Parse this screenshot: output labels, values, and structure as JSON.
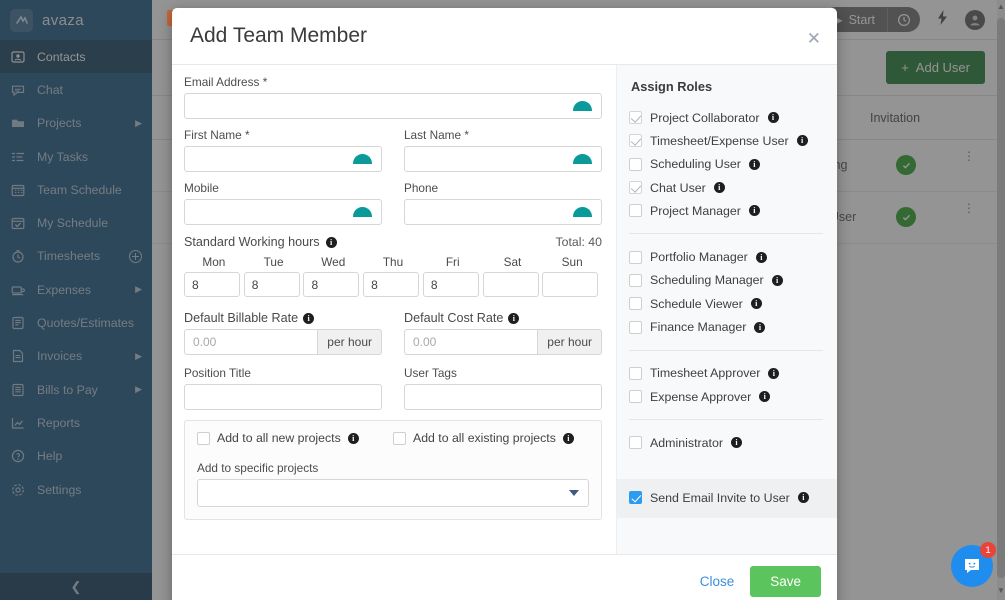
{
  "app": {
    "brand": "avaza",
    "brand_icon": "avaza-logo-icon",
    "collapse_icon": "chevron-left-icon"
  },
  "sidebar": {
    "items": [
      {
        "label": "Contacts",
        "icon": "contact-card-icon",
        "active": true,
        "caret": false,
        "plus": false
      },
      {
        "label": "Chat",
        "icon": "chat-bubble-icon",
        "active": false,
        "caret": false,
        "plus": false
      },
      {
        "label": "Projects",
        "icon": "folder-icon",
        "active": false,
        "caret": true,
        "plus": false
      },
      {
        "label": "My Tasks",
        "icon": "task-list-icon",
        "active": false,
        "caret": false,
        "plus": false
      },
      {
        "label": "Team Schedule",
        "icon": "calendar-icon",
        "active": false,
        "caret": false,
        "plus": false
      },
      {
        "label": "My Schedule",
        "icon": "calendar-check-icon",
        "active": false,
        "caret": false,
        "plus": false
      },
      {
        "label": "Timesheets",
        "icon": "stopwatch-icon",
        "active": false,
        "caret": false,
        "plus": true
      },
      {
        "label": "Expenses",
        "icon": "expense-icon",
        "active": false,
        "caret": true,
        "plus": false
      },
      {
        "label": "Quotes/Estimates",
        "icon": "quote-doc-icon",
        "active": false,
        "caret": false,
        "plus": false
      },
      {
        "label": "Invoices",
        "icon": "invoice-doc-icon",
        "active": false,
        "caret": true,
        "plus": false
      },
      {
        "label": "Bills to Pay",
        "icon": "bill-doc-icon",
        "active": false,
        "caret": true,
        "plus": false
      },
      {
        "label": "Reports",
        "icon": "chart-icon",
        "active": false,
        "caret": false,
        "plus": false
      },
      {
        "label": "Help",
        "icon": "question-circle-icon",
        "active": false,
        "caret": false,
        "plus": false
      },
      {
        "label": "Settings",
        "icon": "gear-icon",
        "active": false,
        "caret": false,
        "plus": false
      }
    ]
  },
  "background": {
    "topbar": {
      "start_label": "Start",
      "timer_icon": "clock-icon",
      "bolt_icon": "lightning-icon",
      "avatar_icon": "user-avatar-icon"
    },
    "add_user_label": "Add User",
    "add_user_icon": "plus-icon",
    "table": {
      "headers": [
        "Invitation"
      ],
      "rows": [
        {
          "text": "ling",
          "invitation": "accepted",
          "menu_icon": "kebab-menu-icon"
        },
        {
          "text": "et User",
          "invitation": "accepted",
          "menu_icon": "kebab-menu-icon"
        }
      ]
    },
    "intercom": {
      "icon": "chat-messenger-icon",
      "badge": "1"
    }
  },
  "modal": {
    "title": "Add Team Member",
    "close_icon": "close-icon",
    "info_icon": "info-icon",
    "autofill_icon": "autofill-arch-icon",
    "fields": {
      "email": {
        "label": "Email Address",
        "required": true,
        "value": ""
      },
      "first_name": {
        "label": "First Name",
        "required": true,
        "value": ""
      },
      "last_name": {
        "label": "Last Name",
        "required": true,
        "value": ""
      },
      "mobile": {
        "label": "Mobile",
        "required": false,
        "value": ""
      },
      "phone": {
        "label": "Phone",
        "required": false,
        "value": ""
      },
      "position_title": {
        "label": "Position Title",
        "value": ""
      },
      "user_tags": {
        "label": "User Tags",
        "value": ""
      }
    },
    "working_hours": {
      "label": "Standard Working hours",
      "total_label": "Total: 40",
      "days": [
        {
          "name": "Mon",
          "value": "8"
        },
        {
          "name": "Tue",
          "value": "8"
        },
        {
          "name": "Wed",
          "value": "8"
        },
        {
          "name": "Thu",
          "value": "8"
        },
        {
          "name": "Fri",
          "value": "8"
        },
        {
          "name": "Sat",
          "value": ""
        },
        {
          "name": "Sun",
          "value": ""
        }
      ]
    },
    "rates": {
      "billable": {
        "label": "Default Billable Rate",
        "placeholder": "0.00",
        "suffix": "per hour"
      },
      "cost": {
        "label": "Default Cost Rate",
        "placeholder": "0.00",
        "suffix": "per hour"
      }
    },
    "projects": {
      "add_new": {
        "label": "Add to all new projects",
        "checked": false
      },
      "add_existing": {
        "label": "Add to all existing projects",
        "checked": false
      },
      "specific_label": "Add to specific projects",
      "specific_value": "",
      "dropdown_icon": "chevron-down-icon"
    },
    "assign_roles": {
      "title": "Assign Roles",
      "groups": [
        [
          {
            "label": "Project Collaborator",
            "checked": true,
            "style": "gray"
          },
          {
            "label": "Timesheet/Expense User",
            "checked": true,
            "style": "gray"
          },
          {
            "label": "Scheduling User",
            "checked": false,
            "style": "gray"
          },
          {
            "label": "Chat User",
            "checked": true,
            "style": "gray"
          },
          {
            "label": "Project Manager",
            "checked": false,
            "style": "gray"
          }
        ],
        [
          {
            "label": "Portfolio Manager",
            "checked": false,
            "style": "gray"
          },
          {
            "label": "Scheduling Manager",
            "checked": false,
            "style": "gray"
          },
          {
            "label": "Schedule Viewer",
            "checked": false,
            "style": "gray"
          },
          {
            "label": "Finance Manager",
            "checked": false,
            "style": "gray"
          }
        ],
        [
          {
            "label": "Timesheet Approver",
            "checked": false,
            "style": "gray"
          },
          {
            "label": "Expense Approver",
            "checked": false,
            "style": "gray"
          }
        ],
        [
          {
            "label": "Administrator",
            "checked": false,
            "style": "gray"
          }
        ]
      ],
      "invite": {
        "label": "Send Email Invite to User",
        "checked": true,
        "style": "blue"
      }
    },
    "footer": {
      "close_label": "Close",
      "save_label": "Save"
    }
  },
  "colors": {
    "sidebar_bg": "#1b5580",
    "sidebar_active": "#15405f",
    "save_green": "#5cc45c",
    "add_user_green": "#1f7a33",
    "link_blue": "#3b8fdc",
    "checkbox_blue": "#2d9cf0",
    "autofill_teal": "#0a9a9a",
    "badge_red": "#e8443a"
  }
}
